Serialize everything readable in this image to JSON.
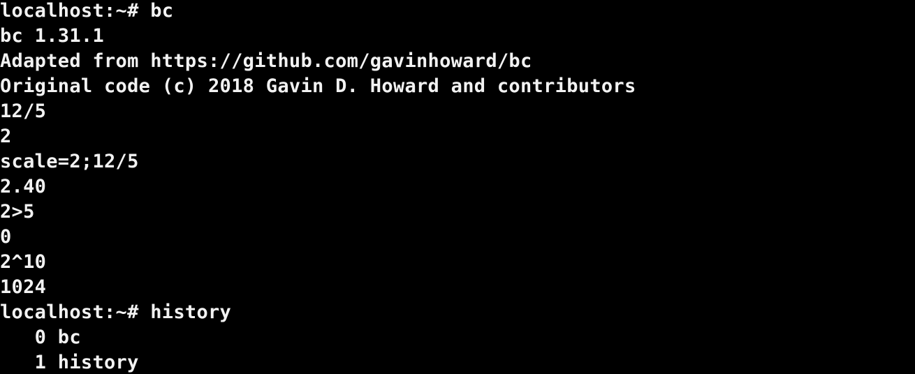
{
  "terminal": {
    "lines": [
      "localhost:~# bc",
      "bc 1.31.1",
      "Adapted from https://github.com/gavinhoward/bc",
      "Original code (c) 2018 Gavin D. Howard and contributors",
      "12/5",
      "2",
      "scale=2;12/5",
      "2.40",
      "2>5",
      "0",
      "2^10",
      "1024",
      "localhost:~# history",
      "   0 bc",
      "   1 history"
    ]
  },
  "colors": {
    "background": "#000000",
    "foreground": "#f2f2f2"
  }
}
